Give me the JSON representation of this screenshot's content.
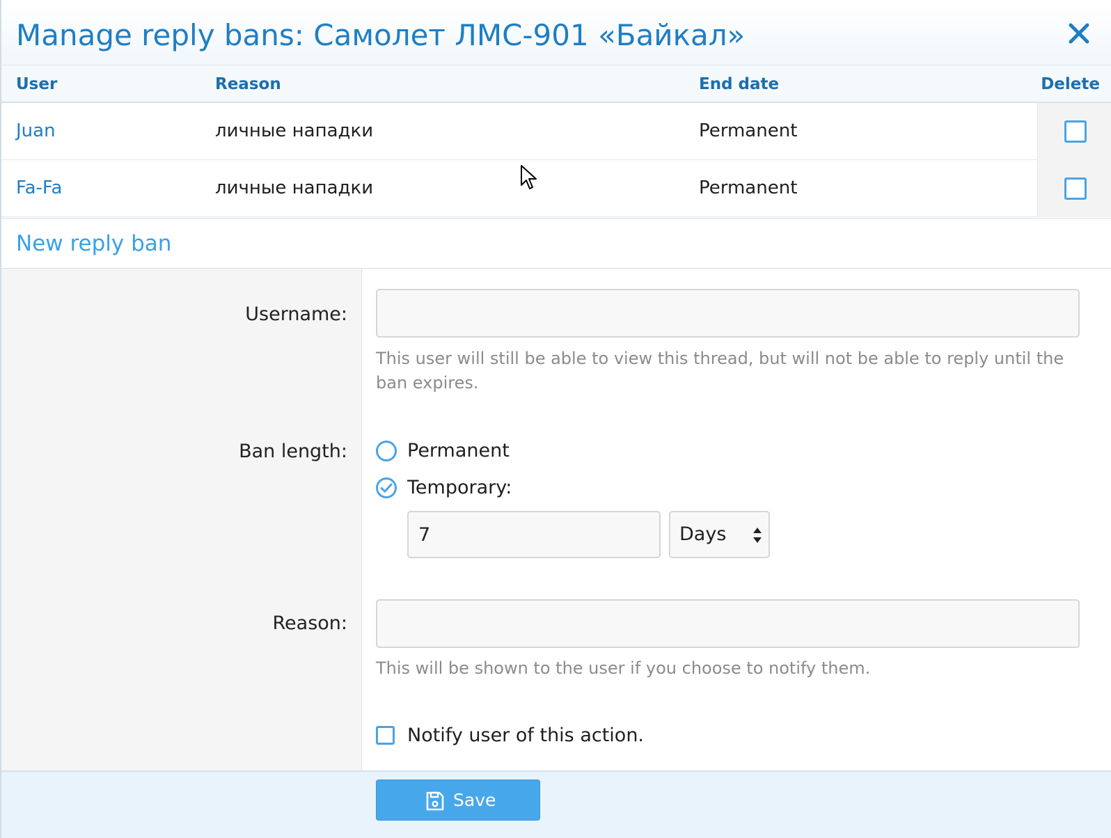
{
  "dialog": {
    "title": "Manage reply bans: Самолет ЛМС-901 «Байкал»",
    "close_icon": "close-icon"
  },
  "table": {
    "headers": {
      "user": "User",
      "reason": "Reason",
      "end_date": "End date",
      "delete": "Delete"
    },
    "rows": [
      {
        "user": "Juan",
        "reason": "личные нападки",
        "end_date": "Permanent",
        "delete_checked": false
      },
      {
        "user": "Fa-Fa",
        "reason": "личные нападки",
        "end_date": "Permanent",
        "delete_checked": false
      }
    ]
  },
  "new_ban": {
    "section_title": "New reply ban",
    "username": {
      "label": "Username:",
      "value": "",
      "help": "This user will still be able to view this thread, but will not be able to reply until the ban expires."
    },
    "ban_length": {
      "label": "Ban length:",
      "options": [
        {
          "label": "Permanent",
          "selected": false
        },
        {
          "label": "Temporary:",
          "selected": true
        }
      ],
      "amount": "7",
      "unit": "Days"
    },
    "reason": {
      "label": "Reason:",
      "value": "",
      "help": "This will be shown to the user if you choose to notify them."
    },
    "notify": {
      "label": "Notify user of this action.",
      "checked": false
    }
  },
  "footer": {
    "save_label": "Save",
    "save_icon": "floppy-disk-icon"
  },
  "colors": {
    "accent": "#1e7ec4",
    "link": "#3ba0e6",
    "button": "#47a7eb",
    "footer_bg": "#e9f3fb"
  }
}
